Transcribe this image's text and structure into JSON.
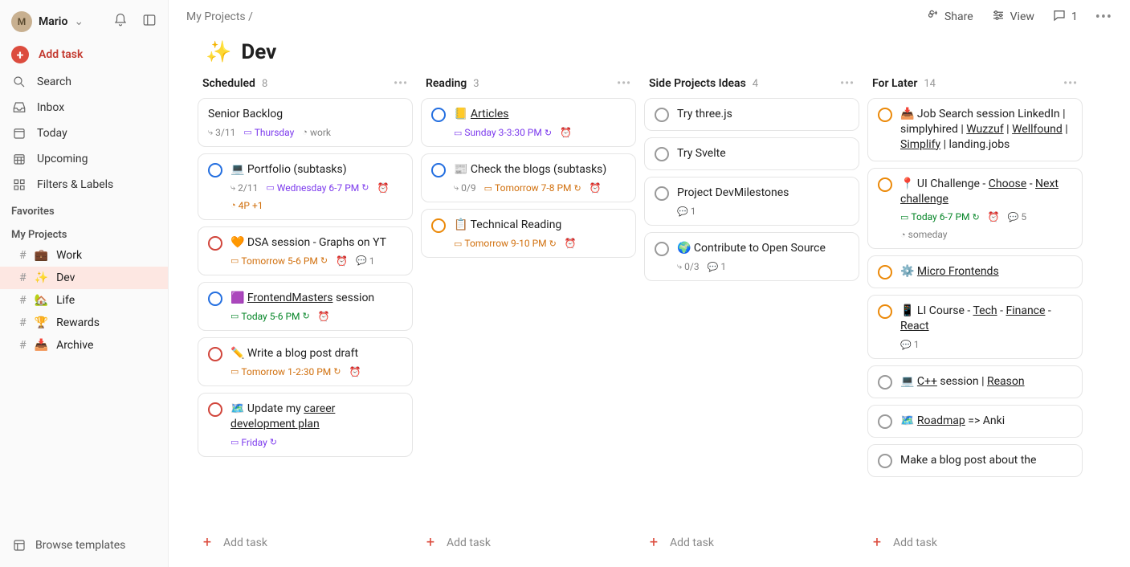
{
  "user": {
    "name": "Mario",
    "initial": "M"
  },
  "sidebar": {
    "add_task": "Add task",
    "search": "Search",
    "inbox": "Inbox",
    "today": "Today",
    "upcoming": "Upcoming",
    "filters": "Filters & Labels",
    "favorites_label": "Favorites",
    "projects_label": "My Projects",
    "projects": [
      {
        "emoji": "💼",
        "name": "Work"
      },
      {
        "emoji": "✨",
        "name": "Dev"
      },
      {
        "emoji": "🏡",
        "name": "Life"
      },
      {
        "emoji": "🏆",
        "name": "Rewards"
      },
      {
        "emoji": "📥",
        "name": "Archive"
      }
    ],
    "browse_templates": "Browse templates"
  },
  "header": {
    "breadcrumb": "My Projects /",
    "share": "Share",
    "view": "View",
    "comments_count": "1"
  },
  "page": {
    "emoji": "✨",
    "title": "Dev"
  },
  "columns": [
    {
      "name": "Scheduled",
      "count": "8",
      "cards": [
        {
          "priority": "",
          "emoji": "",
          "title": "Senior Backlog",
          "meta": [
            {
              "t": "sub",
              "v": "3/11"
            },
            {
              "t": "date",
              "v": "Thursday",
              "c": "purple",
              "cal": true
            },
            {
              "t": "tag",
              "v": "work"
            }
          ]
        },
        {
          "priority": "p3",
          "emoji": "💻",
          "title": "Portfolio (subtasks)",
          "meta": [
            {
              "t": "sub",
              "v": "2/11"
            },
            {
              "t": "date",
              "v": "Wednesday 6-7 PM",
              "c": "purple",
              "cal": true,
              "rec": true
            },
            {
              "t": "clock",
              "v": ""
            },
            {
              "t": "tag",
              "v": "4P +1",
              "c": "orange"
            }
          ]
        },
        {
          "priority": "p1",
          "emoji": "🧡",
          "title": "DSA session - Graphs on YT",
          "meta": [
            {
              "t": "date",
              "v": "Tomorrow 5-6 PM",
              "c": "orange",
              "cal": true,
              "rec": true
            },
            {
              "t": "clock",
              "v": ""
            },
            {
              "t": "cmt",
              "v": "1"
            }
          ]
        },
        {
          "priority": "p3",
          "emoji": "🟪",
          "title_html": "<span class='ul'>FrontendMasters</span> session",
          "meta": [
            {
              "t": "date",
              "v": "Today 5-6 PM",
              "c": "green",
              "cal": true,
              "rec": true
            },
            {
              "t": "clock",
              "v": ""
            }
          ]
        },
        {
          "priority": "p1",
          "emoji": "✏️",
          "title": "Write a blog post draft",
          "meta": [
            {
              "t": "date",
              "v": "Tomorrow 1-2:30 PM",
              "c": "orange",
              "cal": true,
              "rec": true
            },
            {
              "t": "clock",
              "v": ""
            }
          ]
        },
        {
          "priority": "p1",
          "emoji": "🗺️",
          "title_html": "Update my <span class='ul'>career development plan</span>",
          "meta": [
            {
              "t": "date",
              "v": "Friday",
              "c": "purple",
              "cal": true,
              "rec": true
            }
          ]
        }
      ]
    },
    {
      "name": "Reading",
      "count": "3",
      "cards": [
        {
          "priority": "p3",
          "emoji": "📒",
          "title_html": "<span class='ul'>Articles</span>",
          "meta": [
            {
              "t": "date",
              "v": "Sunday 3-3:30 PM",
              "c": "purple",
              "cal": true,
              "rec": true
            },
            {
              "t": "clock",
              "v": ""
            }
          ]
        },
        {
          "priority": "p3",
          "emoji": "📰",
          "title": "Check the blogs (subtasks)",
          "meta": [
            {
              "t": "sub",
              "v": "0/9"
            },
            {
              "t": "date",
              "v": "Tomorrow 7-8 PM",
              "c": "orange",
              "cal": true,
              "rec": true
            },
            {
              "t": "clock",
              "v": ""
            }
          ]
        },
        {
          "priority": "p2",
          "emoji": "📋",
          "title": "Technical Reading",
          "meta": [
            {
              "t": "date",
              "v": "Tomorrow 9-10 PM",
              "c": "orange",
              "cal": true,
              "rec": true
            },
            {
              "t": "clock",
              "v": ""
            }
          ]
        }
      ]
    },
    {
      "name": "Side Projects Ideas",
      "count": "4",
      "cards": [
        {
          "priority": "p4",
          "emoji": "",
          "title": "Try three.js",
          "meta": []
        },
        {
          "priority": "p4",
          "emoji": "",
          "title": "Try Svelte",
          "meta": []
        },
        {
          "priority": "p4",
          "emoji": "",
          "title": "Project DevMilestones",
          "meta": [
            {
              "t": "cmt",
              "v": "1"
            }
          ]
        },
        {
          "priority": "p4",
          "emoji": "🌍",
          "title": "Contribute to Open Source",
          "meta": [
            {
              "t": "sub",
              "v": "0/3"
            },
            {
              "t": "cmt",
              "v": "1"
            }
          ]
        }
      ]
    },
    {
      "name": "For Later",
      "count": "14",
      "cards": [
        {
          "priority": "p2",
          "emoji": "📥",
          "title_html": "Job Search session LinkedIn | simplyhired | <span class='ul'>Wuzzuf</span> | <span class='ul'>Wellfound</span> | <span class='ul'>Simplify</span> | landing.jobs",
          "meta": []
        },
        {
          "priority": "p2",
          "emoji": "📍",
          "title_html": "UI Challenge - <span class='ul'>Choose</span> - <span class='ul'>Next challenge</span>",
          "meta": [
            {
              "t": "date",
              "v": "Today 6-7 PM",
              "c": "green",
              "cal": true,
              "rec": true
            },
            {
              "t": "clock",
              "v": ""
            },
            {
              "t": "cmt",
              "v": "5"
            },
            {
              "t": "tag",
              "v": "someday"
            }
          ]
        },
        {
          "priority": "p2",
          "emoji": "⚙️",
          "title_html": "<span class='ul'>Micro Frontends</span>",
          "meta": []
        },
        {
          "priority": "p2",
          "emoji": "📱",
          "title_html": "LI Course - <span class='ul'>Tech</span> - <span class='ul'>Finance</span> - <span class='ul'>React</span>",
          "meta": [
            {
              "t": "cmt",
              "v": "1"
            }
          ]
        },
        {
          "priority": "p4",
          "emoji": "💻",
          "title_html": "<span class='ul'>C++</span> session | <span class='ul'>Reason</span>",
          "meta": []
        },
        {
          "priority": "p4",
          "emoji": "🗺️",
          "title_html": "<span class='ul'>Roadmap</span> => Anki",
          "meta": []
        },
        {
          "priority": "p4",
          "emoji": "",
          "title": "Make a blog post about the",
          "meta": []
        }
      ]
    }
  ],
  "add_task_label": "Add task"
}
